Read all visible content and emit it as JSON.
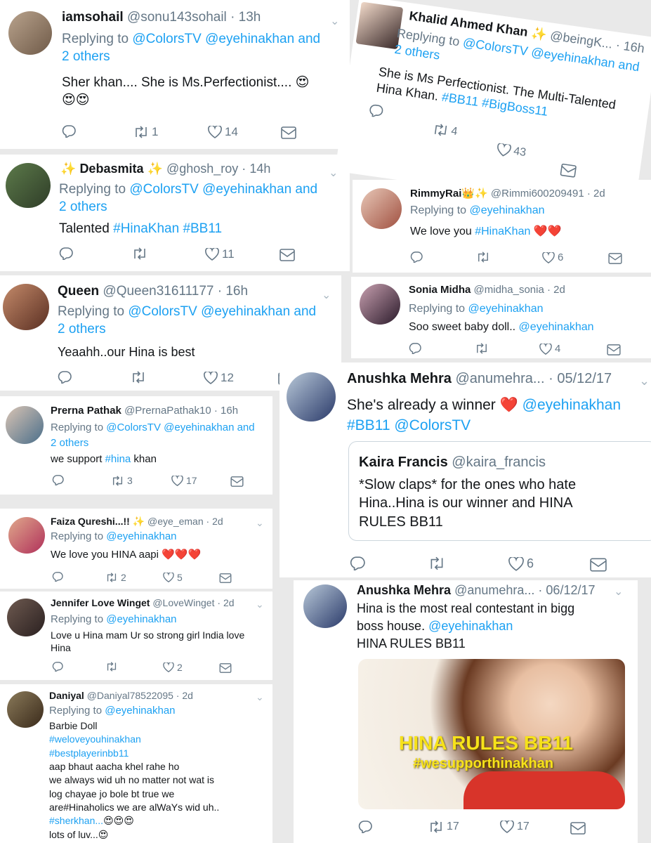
{
  "tweets": [
    {
      "name": "iamsohail",
      "handle": "@sonu143sohail",
      "time": "13h",
      "reply_prefix": "Replying to ",
      "reply_links": "@ColorsTV @eyehinakhan and",
      "reply_line2": "2 others",
      "text": "Sher khan.... She is Ms.Perfectionist.... 😍",
      "text2": "😍😍",
      "retweets": "1",
      "likes": "14"
    },
    {
      "name": "Khalid Ahmed Khan",
      "sparkle": "✨",
      "handle": "@beingK...",
      "time": "16h",
      "reply_prefix": "Replying to ",
      "reply_links": "@ColorsTV @eyehinakhan and",
      "reply_line2": "2 others",
      "text": "She is Ms Perfectionist. The Multi-Talented",
      "text_prefix": "Hina Khan. ",
      "tag1": "#BB11",
      "tag2": "#BigBoss11",
      "retweets": "4",
      "likes": "43"
    },
    {
      "name": "Debasmita",
      "sparkle": "✨",
      "handle": "@ghosh_roy",
      "time": "14h",
      "reply_prefix": "Replying to ",
      "reply_links": "@ColorsTV @eyehinakhan and",
      "reply_line2": "2 others",
      "text_prefix": "Talented ",
      "tag1": "#HinaKhan",
      "tag2": "#BB11",
      "likes": "11"
    },
    {
      "name": "RimmyRai",
      "crown": "👑✨",
      "handle": "@Rimmi600209491",
      "time": "2d",
      "reply_prefix": "Replying to ",
      "reply_links": "@eyehinakhan",
      "text_prefix": "We love you ",
      "tag1": "#HinaKhan",
      "hearts": "❤️❤️",
      "likes": "6"
    },
    {
      "name": "Queen",
      "handle": "@Queen31611177",
      "time": "16h",
      "reply_prefix": "Replying to ",
      "reply_links": "@ColorsTV @eyehinakhan and",
      "reply_line2": "2 others",
      "text": "Yeaahh..our Hina is best",
      "likes": "12"
    },
    {
      "name": "Sonia Midha",
      "handle": "@midha_sonia",
      "time": "2d",
      "reply_prefix": "Replying to ",
      "reply_links": "@eyehinakhan",
      "text_prefix": "Soo sweet baby doll.. ",
      "tag1": "@eyehinakhan",
      "likes": "4"
    },
    {
      "name": "Prerna Pathak",
      "handle": "@PrernaPathak10",
      "time": "16h",
      "reply_prefix": "Replying to ",
      "reply_links": "@ColorsTV @eyehinakhan and",
      "reply_line2": "2 others",
      "text_prefix": "we support ",
      "tag1": "#hina",
      "text_suffix": " khan",
      "retweets": "3",
      "likes": "17"
    },
    {
      "name": "Anushka Mehra",
      "handle": "@anumehra...",
      "time": "05/12/17",
      "text_prefix": "She's already a winner ❤️ ",
      "tag1": "@eyehinakhan",
      "tag2": "#BB11",
      "tag3": "@ColorsTV",
      "quote_name": "Kaira Francis",
      "quote_handle": "@kaira_francis",
      "quote_text": "*Slow claps* for the ones who hate Hina..Hina is our winner and HINA RULES BB11",
      "likes": "6"
    },
    {
      "name": "Faiza Qureshi...!!",
      "sparkle": "✨",
      "handle": "@eye_eman",
      "time": "2d",
      "reply_prefix": "Replying to ",
      "reply_links": "@eyehinakhan",
      "text": "We love you HINA aapi ❤️❤️❤️",
      "retweets": "2",
      "likes": "5"
    },
    {
      "name": "Jennifer Love Winget",
      "handle": "@LoveWinget",
      "time": "2d",
      "reply_prefix": "Replying to ",
      "reply_links": "@eyehinakhan",
      "text": "Love u Hina mam Ur so strong girl India love Hina",
      "likes": "2"
    },
    {
      "name": "Anushka Mehra",
      "handle": "@anumehra...",
      "time": "06/12/17",
      "text_line1": "Hina is the most real contestant in bigg",
      "text_line2_prefix": "boss house. ",
      "tag1": "@eyehinakhan",
      "text_line3": "HINA RULES BB11",
      "image_title": "HINA RULES BB11",
      "image_tag": "#wesupporthinakhan",
      "retweets": "17",
      "likes": "17"
    },
    {
      "name": "Daniyal",
      "handle": "@Daniyal78522095",
      "time": "2d",
      "reply_prefix": "Replying to ",
      "reply_links": "@eyehinakhan",
      "line1": "Barbie Doll",
      "tag1": "#weloveyouhinakhan",
      "tag2": "#bestplayerinbb11",
      "line2": "aap bhaut aacha khel rahe ho",
      "line3": "we always wid uh no matter not wat is",
      "line4": "log chayae jo bole bt true we",
      "line5": "are#Hinaholics we are alWaYs wid uh..",
      "tag3": "#sherkhan...",
      "emoji3": "😍😍😍",
      "line6": "lots of luv...😍"
    }
  ],
  "colors": {
    "link": "#1da1f2",
    "grey": "#657786",
    "heart": "#e0245e",
    "bg": "#e9e9e9"
  },
  "icons": [
    "reply-icon",
    "retweet-icon",
    "like-icon",
    "dm-icon",
    "chevron-down-icon"
  ]
}
